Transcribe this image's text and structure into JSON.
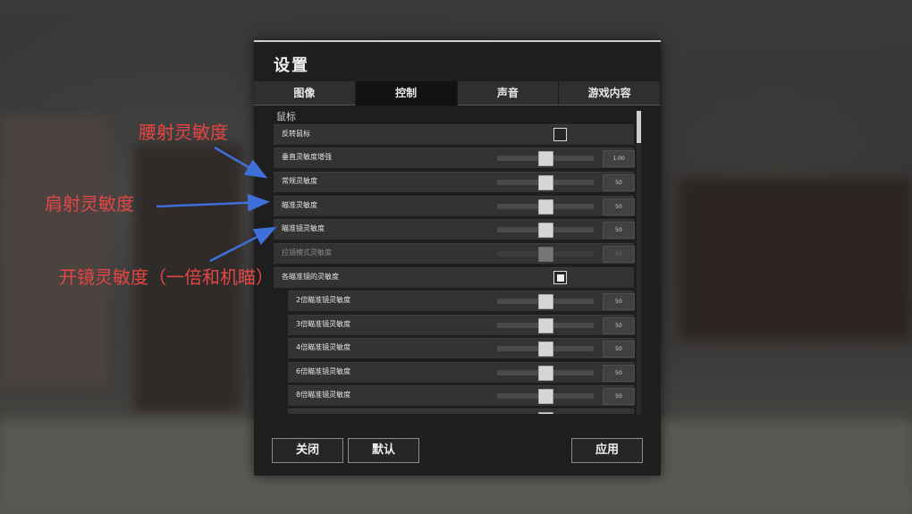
{
  "window": {
    "title": "设置"
  },
  "tabs": [
    {
      "label": "图像",
      "active": false
    },
    {
      "label": "控制",
      "active": true
    },
    {
      "label": "声音",
      "active": false
    },
    {
      "label": "游戏内容",
      "active": false
    }
  ],
  "section": {
    "label": "鼠标"
  },
  "rows": {
    "invert": {
      "label": "反转鼠标",
      "checked": false
    },
    "vertical": {
      "label": "垂直灵敏度增强",
      "value": "1.00"
    },
    "general": {
      "label": "常规灵敏度",
      "value": "50"
    },
    "aim": {
      "label": "瞄准灵敏度",
      "value": "50"
    },
    "scope": {
      "label": "瞄准镜灵敏度",
      "value": "50"
    },
    "scopemode": {
      "label": "拉镜模式灵敏度",
      "value": "50"
    },
    "perscope": {
      "label": "各瞄准镜的灵敏度",
      "checked": true
    },
    "x2": {
      "label": "2倍瞄准镜灵敏度",
      "value": "50"
    },
    "x3": {
      "label": "3倍瞄准镜灵敏度",
      "value": "50"
    },
    "x4": {
      "label": "4倍瞄准镜灵敏度",
      "value": "50"
    },
    "x6": {
      "label": "6倍瞄准镜灵敏度",
      "value": "50"
    },
    "x8": {
      "label": "8倍瞄准镜灵敏度",
      "value": "50"
    }
  },
  "buttons": {
    "close": "关闭",
    "default": "默认",
    "apply": "应用"
  },
  "annotations": {
    "hip": "腰射灵敏度",
    "shoulder": "肩射灵敏度",
    "scope": "开镜灵敏度（一倍和机瞄）"
  },
  "colors": {
    "annotation": "#e64545",
    "arrow": "#3f6fd8"
  }
}
